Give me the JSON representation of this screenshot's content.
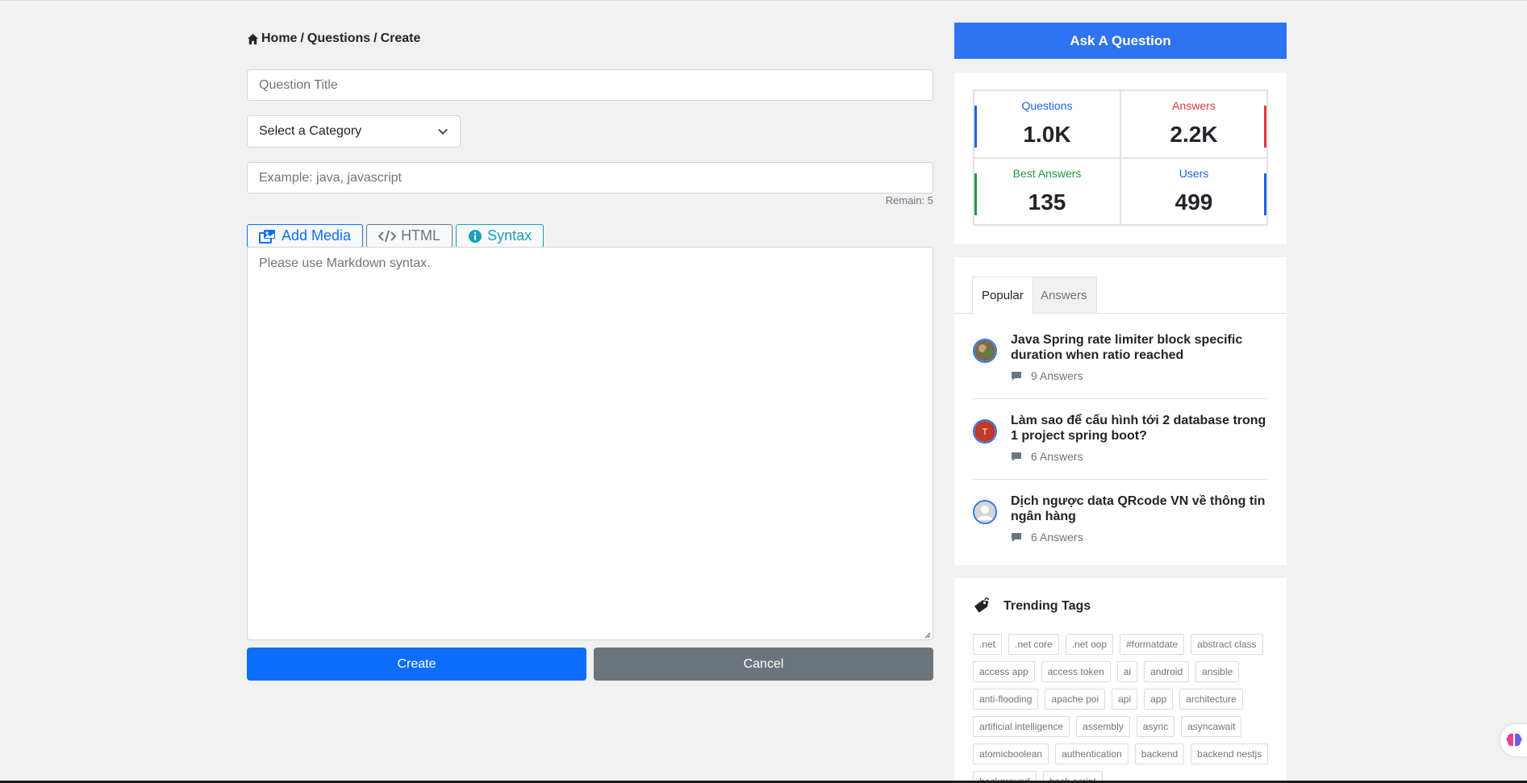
{
  "breadcrumb": {
    "home": "Home",
    "questions": "Questions",
    "create": "Create",
    "sep": "/"
  },
  "form": {
    "title_placeholder": "Question Title",
    "category_selected": "Select a Category",
    "tags_placeholder": "Example: java, javascript",
    "remain": "Remain: 5",
    "editor_tabs": {
      "media": "Add Media",
      "html": "HTML",
      "syntax": "Syntax"
    },
    "body_placeholder": "Please use Markdown syntax.",
    "create_label": "Create",
    "cancel_label": "Cancel"
  },
  "sidebar": {
    "ask_label": "Ask A Question",
    "stats": {
      "questions": {
        "label": "Questions",
        "value": "1.0K"
      },
      "answers": {
        "label": "Answers",
        "value": "2.2K"
      },
      "best": {
        "label": "Best Answers",
        "value": "135"
      },
      "users": {
        "label": "Users",
        "value": "499"
      }
    },
    "tabs": {
      "popular": "Popular",
      "answers": "Answers"
    },
    "popular": [
      {
        "title": "Java Spring rate limiter block specific duration when ratio reached",
        "answers": "9 Answers"
      },
      {
        "title": "Làm sao để cấu hình tới 2 database trong 1 project spring boot?",
        "answers": "6 Answers",
        "avatar_letter": "T"
      },
      {
        "title": "Dịch ngược data QRcode VN về thông tin ngân hàng",
        "answers": "6 Answers"
      }
    ],
    "trending_title": "Trending Tags",
    "tags": [
      ".net",
      ".net core",
      ".net oop",
      "#formatdate",
      "abstract class",
      "access app",
      "access token",
      "ai",
      "android",
      "ansible",
      "anti-flooding",
      "apache poi",
      "api",
      "app",
      "architecture",
      "artificial intelligence",
      "assembly",
      "async",
      "asyncawait",
      "atomicboolean",
      "authentication",
      "backend",
      "backend nestjs",
      "background",
      "bash script"
    ]
  },
  "colors": {
    "primary": "#0d6efd",
    "ask": "#2e73f2",
    "secondary": "#6c757d",
    "info": "#17a2b8",
    "answers_red": "#e03a3a",
    "best_green": "#1f9a43"
  }
}
